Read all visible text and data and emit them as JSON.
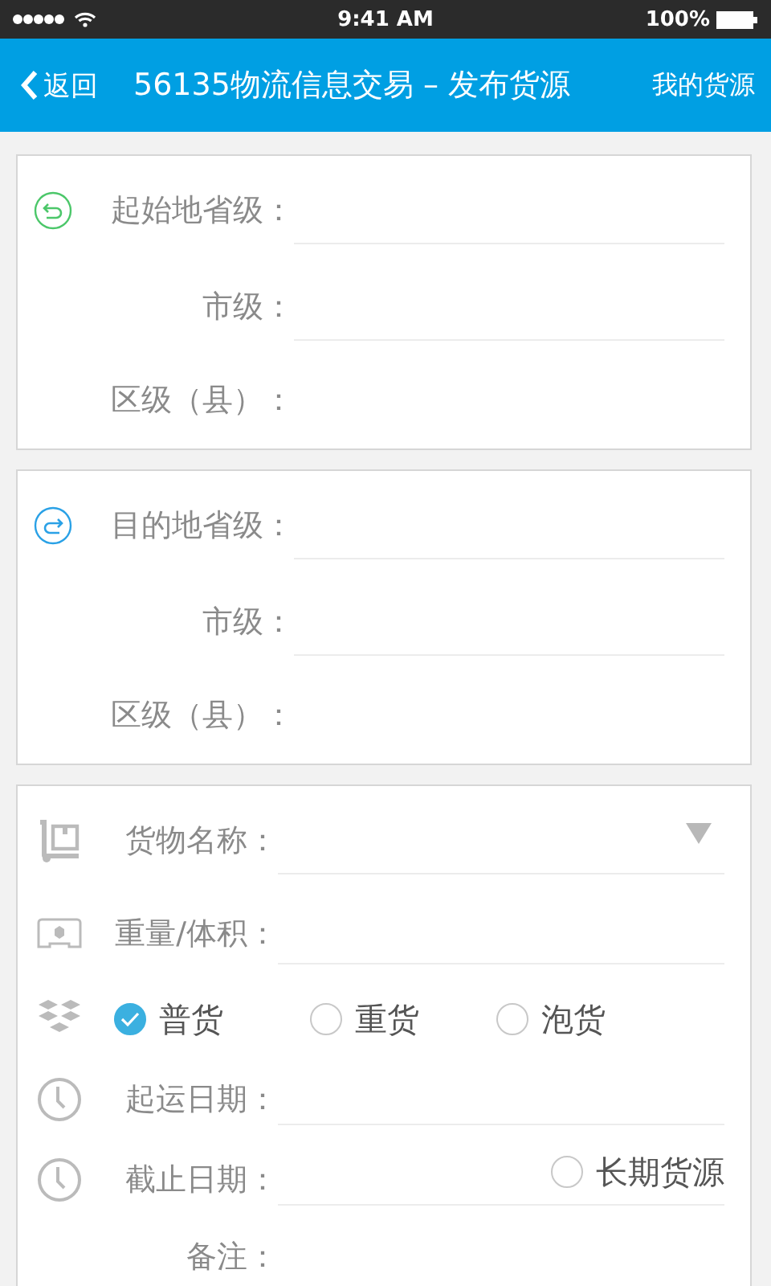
{
  "status_bar": {
    "time": "9:41 AM",
    "battery": "100%"
  },
  "nav": {
    "back": "返回",
    "title": "56135物流信息交易 – 发布货源",
    "action": "我的货源"
  },
  "locations": [
    {
      "kind": "origin",
      "rows": [
        {
          "label": "起始地省级："
        },
        {
          "label": "市级："
        },
        {
          "label": "区级（县）："
        }
      ]
    },
    {
      "kind": "destination",
      "rows": [
        {
          "label": "目的地省级："
        },
        {
          "label": "市级："
        },
        {
          "label": "区级（县）："
        }
      ]
    }
  ],
  "cargo": {
    "rows": [
      {
        "kind": "select",
        "label": "货物名称："
      },
      {
        "kind": "weight",
        "label": "重量/体积："
      },
      {
        "kind": "choice",
        "options": [
          {
            "label": "普货",
            "selected": true
          },
          {
            "label": "重货",
            "selected": false
          },
          {
            "label": "泡货",
            "selected": false
          }
        ]
      },
      {
        "kind": "date",
        "label": "起运日期："
      },
      {
        "kind": "date",
        "label": "截止日期：",
        "option": {
          "label": "长期货源",
          "selected": false
        }
      },
      {
        "kind": "note",
        "label": "备注："
      }
    ]
  }
}
